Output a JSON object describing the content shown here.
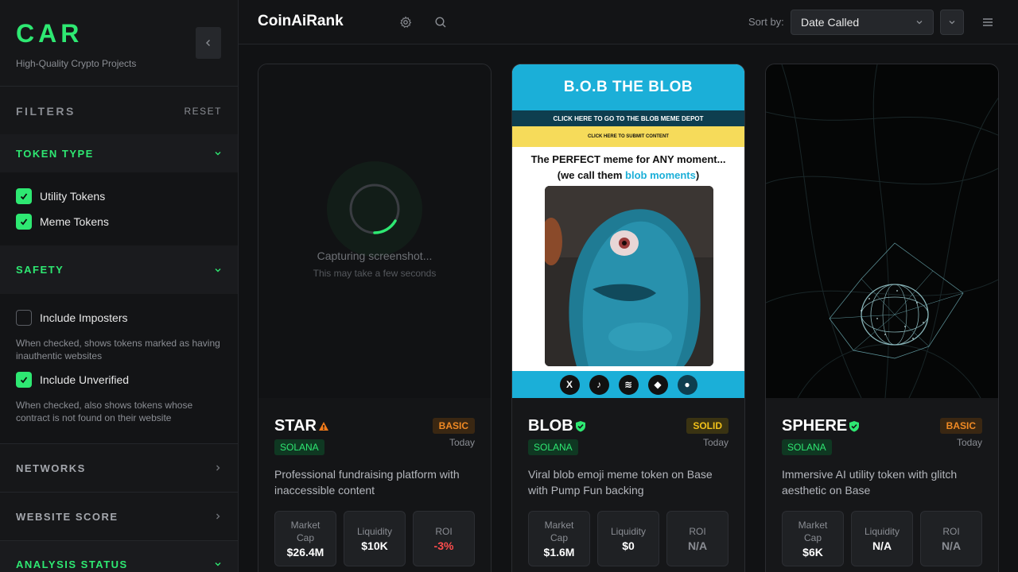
{
  "brand": {
    "title": "CAR",
    "subtitle": "High-Quality Crypto Projects"
  },
  "filters": {
    "title": "FILTERS",
    "reset": "RESET",
    "token_type": {
      "title": "TOKEN TYPE",
      "utility": "Utility Tokens",
      "meme": "Meme Tokens"
    },
    "safety": {
      "title": "SAFETY",
      "imposters": "Include Imposters",
      "imposters_hint": "When checked, shows tokens marked as having inauthentic websites",
      "unverified": "Include Unverified",
      "unverified_hint": "When checked, also shows tokens whose contract is not found on their website"
    },
    "networks": "NETWORKS",
    "website_score": "WEBSITE SCORE",
    "analysis_status": "ANALYSIS STATUS"
  },
  "header": {
    "title": "CoinAiRank",
    "sort_label": "Sort by:",
    "sort_value": "Date Called"
  },
  "stat_labels": {
    "market_cap": "Market Cap",
    "liquidity": "Liquidity",
    "roi": "ROI"
  },
  "cards": [
    {
      "name": "STAR",
      "badge": "BASIC",
      "chain": "SOLANA",
      "date": "Today",
      "desc": "Professional fundraising platform with inaccessible content",
      "market_cap": "$26.4M",
      "liquidity": "$10K",
      "roi": "-3%",
      "loading": "Capturing screenshot...",
      "loading_sub": "This may take a few seconds"
    },
    {
      "name": "BLOB",
      "badge": "SOLID",
      "chain": "SOLANA",
      "date": "Today",
      "desc": "Viral blob emoji meme token on Base with Pump Fun backing",
      "market_cap": "$1.6M",
      "liquidity": "$0",
      "roi": "N/A",
      "site": {
        "title": "B.O.B THE BLOB",
        "link1": "CLICK HERE TO GO TO THE BLOB MEME DEPOT",
        "link2": "CLICK HERE TO SUBMIT CONTENT",
        "tag1": "The PERFECT meme for ANY moment...",
        "tag2a": "(we call them ",
        "tag2b": "blob moments",
        "tag2c": ")"
      }
    },
    {
      "name": "SPHERE",
      "badge": "BASIC",
      "chain": "SOLANA",
      "date": "Today",
      "desc": "Immersive AI utility token with glitch aesthetic on Base",
      "market_cap": "$6K",
      "liquidity": "N/A",
      "roi": "N/A"
    }
  ],
  "colors": {
    "accent": "#2ee872",
    "basic": "#f08a24",
    "solid": "#f2c21a",
    "negative": "#ff4d4d",
    "blob_blue": "#1bafd8"
  }
}
